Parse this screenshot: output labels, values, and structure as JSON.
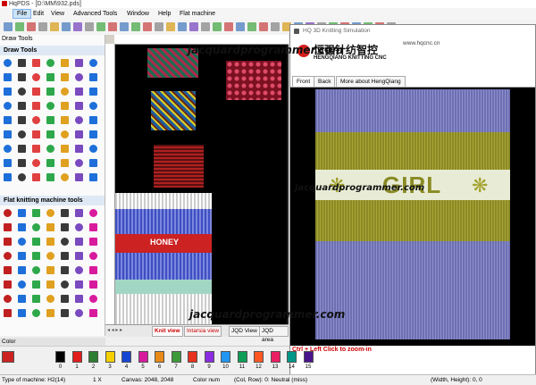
{
  "window": {
    "title": "HqPDS - [D:\\MM\\932.pds]"
  },
  "menu": {
    "items": [
      "File",
      "Edit",
      "View",
      "Advanced Tools",
      "Window",
      "Help",
      "Flat machine"
    ],
    "active": "File"
  },
  "left_panel": {
    "draw_tools_label": "Draw Tools",
    "draw_tools_header": "Draw Tools",
    "flat_tools_header": "Flat knitting machine tools"
  },
  "canvas": {
    "tabs": [
      "Knit view",
      "Intarsia view",
      "JQD View",
      "JQD area"
    ],
    "active_tab": "Knit view",
    "label_text": "HONEY"
  },
  "simulation": {
    "title": "HQ 3D Knitting Simulation",
    "url": "www.hqcnc.cn",
    "logo_cn": "恒强针纺智控",
    "logo_en": "HENGQIANG KNITTING CNC",
    "tabs": [
      "Front",
      "Back",
      "More about HengQiang"
    ],
    "active_tab": "Front",
    "fabric_text": "GIRL",
    "hint": "Ctrl + Left Click to zoom-in"
  },
  "watermark": "jacquardprogrammer.com",
  "color_panel": {
    "label": "Color",
    "numbers": [
      "0",
      "1",
      "2",
      "3",
      "4",
      "5",
      "6",
      "7",
      "8",
      "9",
      "10",
      "11",
      "12",
      "13",
      "14",
      "15"
    ],
    "colors": [
      "#000000",
      "#e21c1c",
      "#2e7d32",
      "#f6d000",
      "#1746d4",
      "#d81b9d",
      "#e88a18",
      "#3d9a3a",
      "#e6321e",
      "#8a2be2",
      "#2196f3",
      "#0f9d58",
      "#ff5722",
      "#e91e63",
      "#009688",
      "#4a148c"
    ]
  },
  "status": {
    "machine_type": "Type of machine: H2(14)",
    "zoom": "1 X",
    "canvas_size": "Canvas: 2048, 2048",
    "color_num": "Color num",
    "col_row": "(Col, Row): 0: Neutral (miss)",
    "width_height": "(Width, Height): 0, 0"
  }
}
